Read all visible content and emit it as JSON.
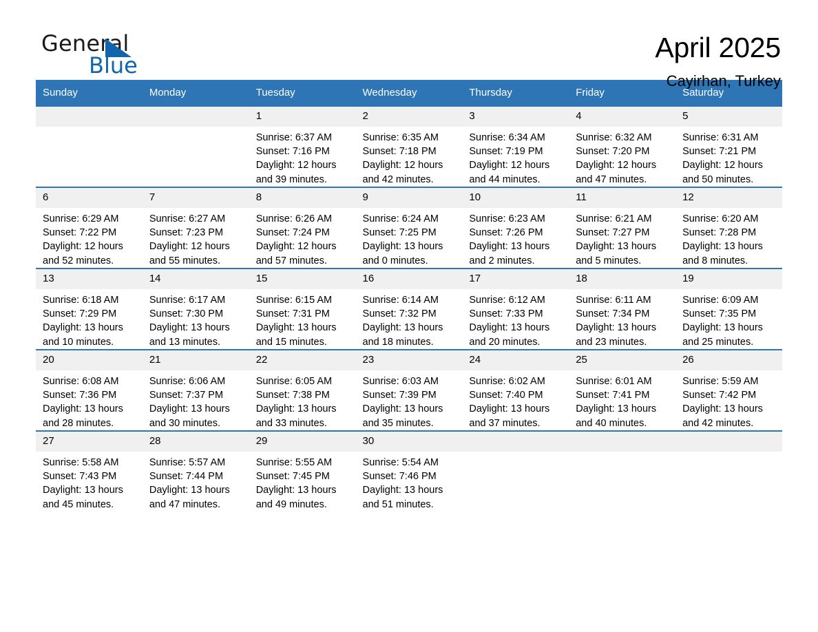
{
  "brand": {
    "name_top": "General",
    "name_bottom": "Blue",
    "triangle_color": "#1066ae",
    "text_color": "#1a1a1a"
  },
  "header": {
    "month_title": "April 2025",
    "location": "Cayirhan, Turkey"
  },
  "theme": {
    "header_blue": "#2e75b6",
    "daynum_band": "#f0f0f0",
    "page_background": "#ffffff"
  },
  "calendar": {
    "weekday_headers": [
      "Sunday",
      "Monday",
      "Tuesday",
      "Wednesday",
      "Thursday",
      "Friday",
      "Saturday"
    ],
    "weeks": [
      [
        {
          "day": "",
          "blank": true
        },
        {
          "day": "",
          "blank": true
        },
        {
          "day": "1",
          "sunrise": "Sunrise: 6:37 AM",
          "sunset": "Sunset: 7:16 PM",
          "daylight_1": "Daylight: 12 hours",
          "daylight_2": "and 39 minutes."
        },
        {
          "day": "2",
          "sunrise": "Sunrise: 6:35 AM",
          "sunset": "Sunset: 7:18 PM",
          "daylight_1": "Daylight: 12 hours",
          "daylight_2": "and 42 minutes."
        },
        {
          "day": "3",
          "sunrise": "Sunrise: 6:34 AM",
          "sunset": "Sunset: 7:19 PM",
          "daylight_1": "Daylight: 12 hours",
          "daylight_2": "and 44 minutes."
        },
        {
          "day": "4",
          "sunrise": "Sunrise: 6:32 AM",
          "sunset": "Sunset: 7:20 PM",
          "daylight_1": "Daylight: 12 hours",
          "daylight_2": "and 47 minutes."
        },
        {
          "day": "5",
          "sunrise": "Sunrise: 6:31 AM",
          "sunset": "Sunset: 7:21 PM",
          "daylight_1": "Daylight: 12 hours",
          "daylight_2": "and 50 minutes."
        }
      ],
      [
        {
          "day": "6",
          "sunrise": "Sunrise: 6:29 AM",
          "sunset": "Sunset: 7:22 PM",
          "daylight_1": "Daylight: 12 hours",
          "daylight_2": "and 52 minutes."
        },
        {
          "day": "7",
          "sunrise": "Sunrise: 6:27 AM",
          "sunset": "Sunset: 7:23 PM",
          "daylight_1": "Daylight: 12 hours",
          "daylight_2": "and 55 minutes."
        },
        {
          "day": "8",
          "sunrise": "Sunrise: 6:26 AM",
          "sunset": "Sunset: 7:24 PM",
          "daylight_1": "Daylight: 12 hours",
          "daylight_2": "and 57 minutes."
        },
        {
          "day": "9",
          "sunrise": "Sunrise: 6:24 AM",
          "sunset": "Sunset: 7:25 PM",
          "daylight_1": "Daylight: 13 hours",
          "daylight_2": "and 0 minutes."
        },
        {
          "day": "10",
          "sunrise": "Sunrise: 6:23 AM",
          "sunset": "Sunset: 7:26 PM",
          "daylight_1": "Daylight: 13 hours",
          "daylight_2": "and 2 minutes."
        },
        {
          "day": "11",
          "sunrise": "Sunrise: 6:21 AM",
          "sunset": "Sunset: 7:27 PM",
          "daylight_1": "Daylight: 13 hours",
          "daylight_2": "and 5 minutes."
        },
        {
          "day": "12",
          "sunrise": "Sunrise: 6:20 AM",
          "sunset": "Sunset: 7:28 PM",
          "daylight_1": "Daylight: 13 hours",
          "daylight_2": "and 8 minutes."
        }
      ],
      [
        {
          "day": "13",
          "sunrise": "Sunrise: 6:18 AM",
          "sunset": "Sunset: 7:29 PM",
          "daylight_1": "Daylight: 13 hours",
          "daylight_2": "and 10 minutes."
        },
        {
          "day": "14",
          "sunrise": "Sunrise: 6:17 AM",
          "sunset": "Sunset: 7:30 PM",
          "daylight_1": "Daylight: 13 hours",
          "daylight_2": "and 13 minutes."
        },
        {
          "day": "15",
          "sunrise": "Sunrise: 6:15 AM",
          "sunset": "Sunset: 7:31 PM",
          "daylight_1": "Daylight: 13 hours",
          "daylight_2": "and 15 minutes."
        },
        {
          "day": "16",
          "sunrise": "Sunrise: 6:14 AM",
          "sunset": "Sunset: 7:32 PM",
          "daylight_1": "Daylight: 13 hours",
          "daylight_2": "and 18 minutes."
        },
        {
          "day": "17",
          "sunrise": "Sunrise: 6:12 AM",
          "sunset": "Sunset: 7:33 PM",
          "daylight_1": "Daylight: 13 hours",
          "daylight_2": "and 20 minutes."
        },
        {
          "day": "18",
          "sunrise": "Sunrise: 6:11 AM",
          "sunset": "Sunset: 7:34 PM",
          "daylight_1": "Daylight: 13 hours",
          "daylight_2": "and 23 minutes."
        },
        {
          "day": "19",
          "sunrise": "Sunrise: 6:09 AM",
          "sunset": "Sunset: 7:35 PM",
          "daylight_1": "Daylight: 13 hours",
          "daylight_2": "and 25 minutes."
        }
      ],
      [
        {
          "day": "20",
          "sunrise": "Sunrise: 6:08 AM",
          "sunset": "Sunset: 7:36 PM",
          "daylight_1": "Daylight: 13 hours",
          "daylight_2": "and 28 minutes."
        },
        {
          "day": "21",
          "sunrise": "Sunrise: 6:06 AM",
          "sunset": "Sunset: 7:37 PM",
          "daylight_1": "Daylight: 13 hours",
          "daylight_2": "and 30 minutes."
        },
        {
          "day": "22",
          "sunrise": "Sunrise: 6:05 AM",
          "sunset": "Sunset: 7:38 PM",
          "daylight_1": "Daylight: 13 hours",
          "daylight_2": "and 33 minutes."
        },
        {
          "day": "23",
          "sunrise": "Sunrise: 6:03 AM",
          "sunset": "Sunset: 7:39 PM",
          "daylight_1": "Daylight: 13 hours",
          "daylight_2": "and 35 minutes."
        },
        {
          "day": "24",
          "sunrise": "Sunrise: 6:02 AM",
          "sunset": "Sunset: 7:40 PM",
          "daylight_1": "Daylight: 13 hours",
          "daylight_2": "and 37 minutes."
        },
        {
          "day": "25",
          "sunrise": "Sunrise: 6:01 AM",
          "sunset": "Sunset: 7:41 PM",
          "daylight_1": "Daylight: 13 hours",
          "daylight_2": "and 40 minutes."
        },
        {
          "day": "26",
          "sunrise": "Sunrise: 5:59 AM",
          "sunset": "Sunset: 7:42 PM",
          "daylight_1": "Daylight: 13 hours",
          "daylight_2": "and 42 minutes."
        }
      ],
      [
        {
          "day": "27",
          "sunrise": "Sunrise: 5:58 AM",
          "sunset": "Sunset: 7:43 PM",
          "daylight_1": "Daylight: 13 hours",
          "daylight_2": "and 45 minutes."
        },
        {
          "day": "28",
          "sunrise": "Sunrise: 5:57 AM",
          "sunset": "Sunset: 7:44 PM",
          "daylight_1": "Daylight: 13 hours",
          "daylight_2": "and 47 minutes."
        },
        {
          "day": "29",
          "sunrise": "Sunrise: 5:55 AM",
          "sunset": "Sunset: 7:45 PM",
          "daylight_1": "Daylight: 13 hours",
          "daylight_2": "and 49 minutes."
        },
        {
          "day": "30",
          "sunrise": "Sunrise: 5:54 AM",
          "sunset": "Sunset: 7:46 PM",
          "daylight_1": "Daylight: 13 hours",
          "daylight_2": "and 51 minutes."
        },
        {
          "day": "",
          "blank": true
        },
        {
          "day": "",
          "blank": true
        },
        {
          "day": "",
          "blank": true
        }
      ]
    ]
  }
}
